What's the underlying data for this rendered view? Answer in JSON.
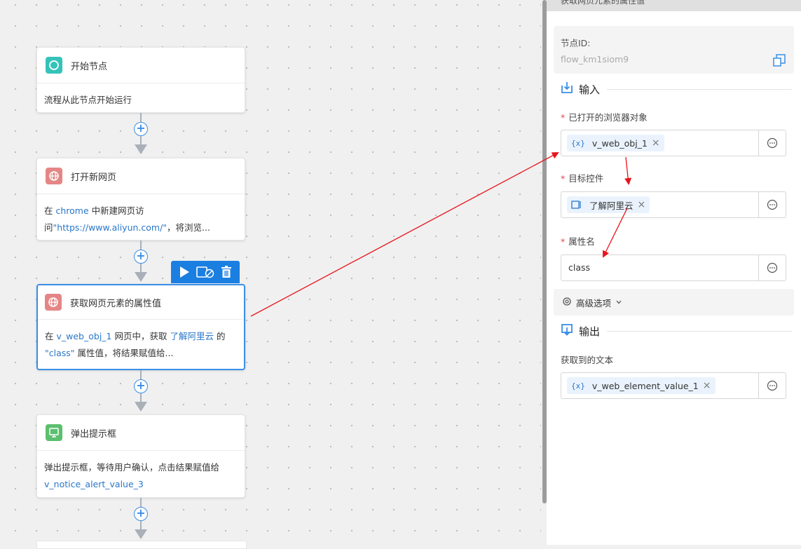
{
  "canvas": {
    "nodes": [
      {
        "title": "开始节点",
        "desc_parts": [
          {
            "t": "流程从此节点开始运行"
          }
        ],
        "icon": "circle-icon",
        "icon_bg": "#35c3b9"
      },
      {
        "title": "打开新网页",
        "desc_parts": [
          {
            "t": "在 "
          },
          {
            "t": "chrome",
            "hl": true
          },
          {
            "t": " 中新建网页访问"
          },
          {
            "t": "\"https://www.aliyun.com/\"",
            "hl": true
          },
          {
            "t": "，将浏览..."
          }
        ],
        "icon": "globe-icon",
        "icon_bg": "#e58686"
      },
      {
        "title": "获取网页元素的属性值",
        "desc_parts": [
          {
            "t": "在 "
          },
          {
            "t": "v_web_obj_1",
            "hl": true
          },
          {
            "t": " 网页中，获取 "
          },
          {
            "t": "了解阿里云",
            "hl": true
          },
          {
            "t": " 的 "
          },
          {
            "t": "\"class\"",
            "hl": true
          },
          {
            "t": " 属性值，将结果赋值给..."
          }
        ],
        "icon": "globe-icon",
        "icon_bg": "#e58686"
      },
      {
        "title": "弹出提示框",
        "desc_parts": [
          {
            "t": "弹出提示框，等待用户确认，点击结果赋值给 "
          },
          {
            "t": "v_notice_alert_value_3",
            "hl": true
          }
        ],
        "icon": "monitor-icon",
        "icon_bg": "#5cbf6e"
      }
    ]
  },
  "panel": {
    "title": "获取网页元素的属性值",
    "node_id_label": "节点ID:",
    "node_id_value": "flow_km1siom9",
    "input_section": "输入",
    "fields": {
      "browser_label": "已打开的浏览器对象",
      "browser_value": "v_web_obj_1",
      "target_label": "目标控件",
      "target_value": "了解阿里云",
      "attr_label": "属性名",
      "attr_value": "class"
    },
    "advanced": "高级选项",
    "output_section": "输出",
    "output_label": "获取到的文本",
    "output_value": "v_web_element_value_1",
    "var_icon": "{x}",
    "close_glyph": "×"
  },
  "colors": {
    "accent": "#1a7fe0",
    "annotation": "#e8141c"
  }
}
